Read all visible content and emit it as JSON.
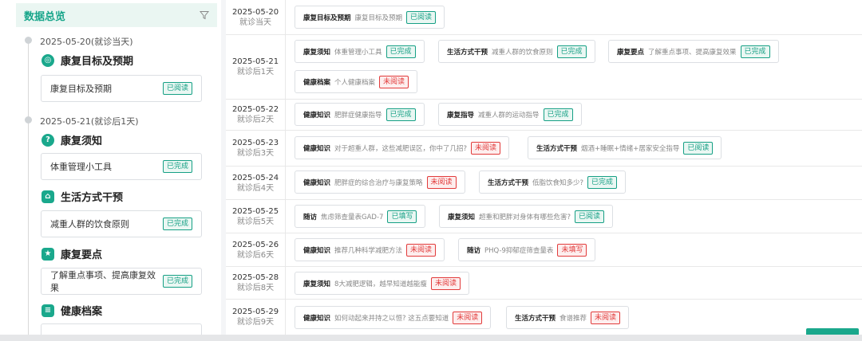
{
  "left": {
    "title": "数据总览",
    "days": [
      {
        "date": "2025-05-20(就诊当天)"
      },
      {
        "date": "2025-05-21(就诊后1天)"
      }
    ],
    "sections": [
      {
        "label": "康复目标及预期",
        "icon": "target-icon",
        "item": "康复目标及预期",
        "status": "已阅读",
        "status_color": "green"
      },
      {
        "label": "康复须知",
        "icon": "question-icon",
        "item": "体重管理小工具",
        "status": "已完成",
        "status_color": "green"
      },
      {
        "label": "生活方式干预",
        "icon": "home-icon",
        "item": "减重人群的饮食原则",
        "status": "已完成",
        "status_color": "green"
      },
      {
        "label": "康复要点",
        "icon": "star-icon",
        "item": "了解重点事项、提高康复效果",
        "status": "已完成",
        "status_color": "green"
      },
      {
        "label": "健康档案",
        "icon": "document-icon"
      }
    ]
  },
  "rows": [
    {
      "date": "2025-05-20",
      "rel": "就诊当天",
      "cards": [
        {
          "title": "康复目标及预期",
          "desc": "康复目标及预期",
          "status": "已阅读",
          "color": "green"
        }
      ]
    },
    {
      "date": "2025-05-21",
      "rel": "就诊后1天",
      "cards": [
        {
          "title": "康复须知",
          "desc": "体重管理小工具",
          "status": "已完成",
          "color": "green"
        },
        {
          "title": "生活方式干预",
          "desc": "减重人群的饮食原则",
          "status": "已完成",
          "color": "green"
        },
        {
          "title": "康复要点",
          "desc": "了解重点事项、提高康复效果",
          "status": "已完成",
          "color": "green"
        },
        {
          "title": "健康档案",
          "desc": "个人健康档案",
          "status": "未阅读",
          "color": "red"
        }
      ]
    },
    {
      "date": "2025-05-22",
      "rel": "就诊后2天",
      "cards": [
        {
          "title": "健康知识",
          "desc": "肥胖症健康指导",
          "status": "已完成",
          "color": "green"
        },
        {
          "title": "康复指导",
          "desc": "减重人群的运动指导",
          "status": "已完成",
          "color": "green"
        }
      ]
    },
    {
      "date": "2025-05-23",
      "rel": "就诊后3天",
      "cards": [
        {
          "title": "健康知识",
          "desc": "对于超重人群，这些减肥误区，你中了几招?",
          "status": "未阅读",
          "color": "red"
        },
        {
          "title": "生活方式干预",
          "desc": "烟酒+睡眠+情绪+居家安全指导",
          "status": "已阅读",
          "color": "green"
        }
      ]
    },
    {
      "date": "2025-05-24",
      "rel": "就诊后4天",
      "cards": [
        {
          "title": "健康知识",
          "desc": "肥胖症的综合治疗与康复策略",
          "status": "未阅读",
          "color": "red"
        },
        {
          "title": "生活方式干预",
          "desc": "低脂饮食知多少?",
          "status": "已完成",
          "color": "green"
        }
      ]
    },
    {
      "date": "2025-05-25",
      "rel": "就诊后5天",
      "cards": [
        {
          "title": "随访",
          "desc": "焦虑筛查量表GAD-7",
          "status": "已填写",
          "color": "green"
        },
        {
          "title": "康复须知",
          "desc": "超重和肥胖对身体有哪些危害?",
          "status": "已阅读",
          "color": "green"
        }
      ]
    },
    {
      "date": "2025-05-26",
      "rel": "就诊后6天",
      "cards": [
        {
          "title": "健康知识",
          "desc": "推荐几种科学减肥方法",
          "status": "未阅读",
          "color": "red"
        },
        {
          "title": "随访",
          "desc": "PHQ-9抑郁症筛查量表",
          "status": "未填写",
          "color": "red"
        }
      ]
    },
    {
      "date": "2025-05-28",
      "rel": "就诊后8天",
      "cards": [
        {
          "title": "康复须知",
          "desc": "8大减肥逻辑，越早知道越能瘦",
          "status": "未阅读",
          "color": "red"
        }
      ]
    },
    {
      "date": "2025-05-29",
      "rel": "就诊后9天",
      "cards": [
        {
          "title": "健康知识",
          "desc": "如何动起来并持之以恒? 这五点要知道",
          "status": "未阅读",
          "color": "red"
        },
        {
          "title": "生活方式干预",
          "desc": "食谱推荐",
          "status": "未阅读",
          "color": "red"
        }
      ]
    }
  ],
  "colors": {
    "accent": "#1aa88c",
    "done": "#16a085",
    "pending": "#e23b3b"
  }
}
